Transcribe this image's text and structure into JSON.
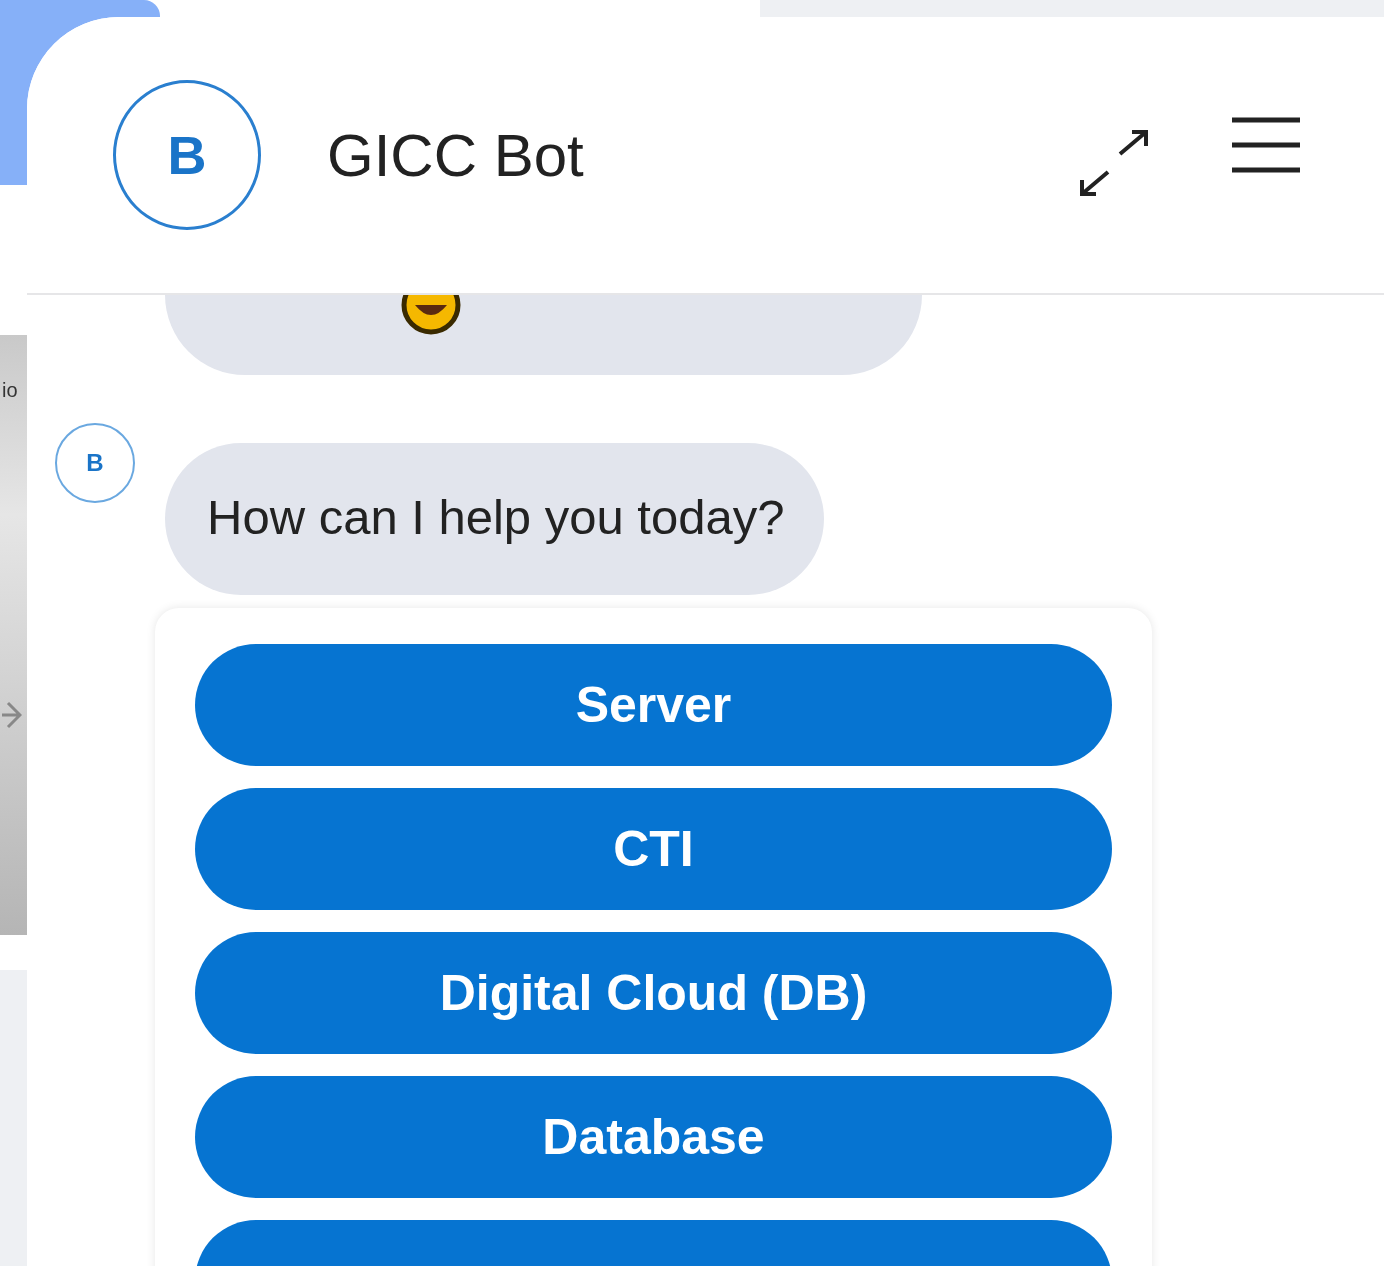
{
  "background": {
    "side_text": "io"
  },
  "chat": {
    "title": "GICC Bot",
    "avatar": "B",
    "messages": [
      {
        "kind": "cut"
      },
      {
        "kind": "text",
        "avatar": "B",
        "text": "How can I help you today?"
      }
    ],
    "options": [
      {
        "kind": "option",
        "label": "Server"
      },
      {
        "kind": "option",
        "label": "CTI"
      },
      {
        "kind": "option",
        "label": "Digital Cloud (DB)"
      },
      {
        "kind": "option",
        "label": "Database"
      },
      {
        "kind": "cut"
      }
    ]
  }
}
